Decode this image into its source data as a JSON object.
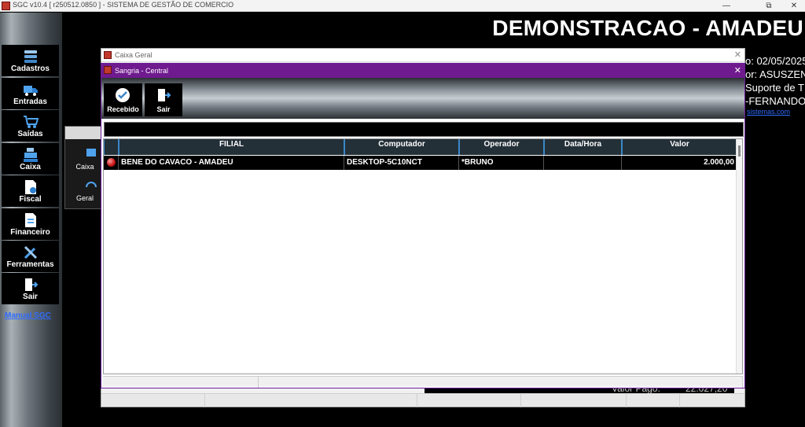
{
  "os": {
    "title": "SGC v10.4 [ r250512.0850 ] - SISTEMA DE GESTÃO DE COMERCIO",
    "minimize": "—",
    "maximize": "⧉",
    "close": "✕"
  },
  "menu": {
    "items": [
      {
        "label": "Cadastros",
        "icon": "cadastros-icon"
      },
      {
        "label": "Entradas",
        "icon": "truck-icon"
      },
      {
        "label": "Saídas",
        "icon": "cart-icon"
      },
      {
        "label": "Caixa",
        "icon": "cash-register-icon"
      },
      {
        "label": "Fiscal",
        "icon": "fiscal-document-icon"
      },
      {
        "label": "Financeiro",
        "icon": "financial-document-icon"
      },
      {
        "label": "Ferramentas",
        "icon": "tools-icon"
      },
      {
        "label": "Sair",
        "icon": "exit-door-icon"
      }
    ],
    "manual_link": "Manual SGC"
  },
  "submenu": {
    "items": [
      {
        "label": "Caixa"
      },
      {
        "label": "Geral"
      }
    ]
  },
  "background": {
    "title": "DEMONSTRACAO - AMADEU",
    "info_lines": [
      "o: 02/05/2025",
      "or: ASUSZEN",
      "Suporte de TI",
      "-FERNANDO"
    ],
    "link": "sistemas.com"
  },
  "caixa_geral": {
    "title": "Caixa Geral",
    "valor_pago_label": "Valor Pago:",
    "valor_pago_value": "22.027,20"
  },
  "sangria": {
    "title": "Sangria - Central",
    "toolbar": {
      "recebido_label": "Recebido",
      "sair_label": "Sair"
    },
    "grid": {
      "columns": [
        "FILIAL",
        "Computador",
        "Operador",
        "Data/Hora",
        "Valor"
      ],
      "rows": [
        {
          "filial": "BENE DO CAVACO - AMADEU",
          "computador": "DESKTOP-5C10NCT",
          "operador": "*BRUNO",
          "data_hora": "",
          "valor": "2.000,00",
          "status_color": "#c41212"
        }
      ]
    }
  },
  "colors": {
    "dialog_titlebar": "#6f1a8e",
    "grid_header": "#233038",
    "link": "#2f6cff"
  }
}
